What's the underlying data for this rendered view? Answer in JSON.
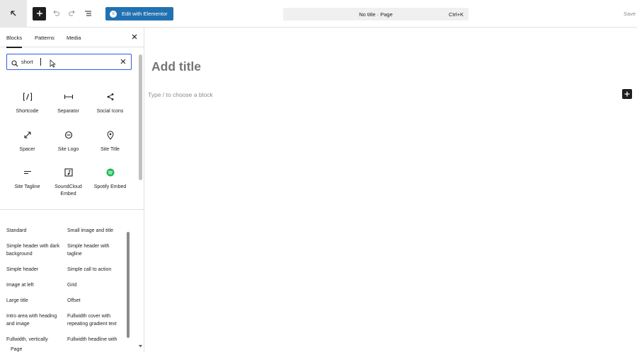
{
  "topbar": {
    "elementor_label": "Edit with Elementor",
    "command_title": "No title · Page",
    "command_shortcut": "Ctrl+K",
    "save_label": "Save"
  },
  "sidebar": {
    "tabs": [
      {
        "label": "Blocks",
        "active": true
      },
      {
        "label": "Patterns",
        "active": false
      },
      {
        "label": "Media",
        "active": false
      }
    ],
    "search": {
      "value": "short",
      "placeholder": "Search"
    },
    "blocks": [
      {
        "label": "Shortcode",
        "icon": "shortcode-icon"
      },
      {
        "label": "Separator",
        "icon": "separator-icon"
      },
      {
        "label": "Social Icons",
        "icon": "share-icon"
      },
      {
        "label": "Spacer",
        "icon": "spacer-icon"
      },
      {
        "label": "Site Logo",
        "icon": "site-logo-icon"
      },
      {
        "label": "Site Title",
        "icon": "map-marker-icon"
      },
      {
        "label": "Site Tagline",
        "icon": "tagline-icon"
      },
      {
        "label": "SoundCloud Embed",
        "icon": "soundcloud-icon"
      },
      {
        "label": "Spotify Embed",
        "icon": "spotify-icon"
      }
    ],
    "patterns": [
      "Standard",
      "Small image and title",
      "Simple header with dark background",
      "Simple header with tagline",
      "Simple header",
      "Simple call to action",
      "Image at left",
      "Grid",
      "Large title",
      "Offset",
      "Intro area with heading and image",
      "Fullwidth cover with repeating gradient text",
      "Fullwidth, vertically",
      "Fullwidth headline with"
    ],
    "footer_crumb": "Page"
  },
  "canvas": {
    "title_placeholder": "Add title",
    "block_hint": "Type / to choose a block"
  },
  "colors": {
    "accent": "#3858e9",
    "elementor": "#2271b1",
    "spotify": "#1db954"
  }
}
